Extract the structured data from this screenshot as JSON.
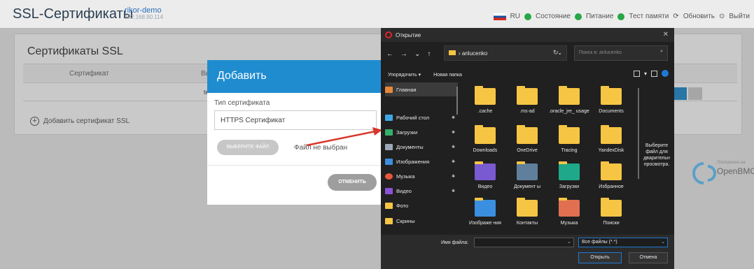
{
  "app": {
    "title": "SSL-Сертификаты",
    "host_name": "rikor-demo",
    "host_ip": "192.168.90.114"
  },
  "status_bar": {
    "lang": "RU",
    "state": "Состояние",
    "power": "Питание",
    "memtest": "Тест памяти",
    "refresh": "Обновить",
    "exit": "Выйти"
  },
  "card": {
    "title": "Сертификаты SSL",
    "col_cert": "Сертификат",
    "col_issued": "Выдан",
    "row_issued": "testho",
    "add_link": "Добавить сертификат SSL"
  },
  "add_dialog": {
    "title": "Добавить",
    "type_label": "Тип сертификата",
    "type_value": "HTTPS Сертификат",
    "choose_button": "ВЫБЕРИТЕ ФАЙЛ",
    "no_file": "Файл не выбран",
    "cancel_button": "ОТМЕНИТЬ"
  },
  "file_dialog": {
    "title": "Открытие",
    "path": "anlucenko",
    "search_placeholder": "Поиск в: anlucenko",
    "organize": "Упорядочить ▾",
    "new_folder": "Новая папка",
    "sidebar": [
      {
        "label": "Главная",
        "color": "#e8873a",
        "pinned": false
      },
      {
        "label": "Рабочий стол",
        "color": "#3fa7e6",
        "pinned": true
      },
      {
        "label": "Загрузки",
        "color": "#35b06a",
        "pinned": true
      },
      {
        "label": "Документы",
        "color": "#9aa7b6",
        "pinned": true
      },
      {
        "label": "Изображения",
        "color": "#3b8fe0",
        "pinned": true
      },
      {
        "label": "Музыка",
        "color": "#e8553a",
        "pinned": true
      },
      {
        "label": "Видео",
        "color": "#8a52d6",
        "pinned": true
      },
      {
        "label": "Фото",
        "color": "#f6c544",
        "pinned": false
      },
      {
        "label": "Скрины",
        "color": "#f6c544",
        "pinned": false
      }
    ],
    "files": [
      {
        "label": ".cache"
      },
      {
        "label": ".ms-ad"
      },
      {
        "label": ".oracle_jre_ usage"
      },
      {
        "label": "Documents"
      },
      {
        "label": "Downloads"
      },
      {
        "label": "OneDrive"
      },
      {
        "label": "Tracing"
      },
      {
        "label": "YandexDisk"
      },
      {
        "label": "Видео"
      },
      {
        "label": "Документ ы"
      },
      {
        "label": "Загрузки"
      },
      {
        "label": "Избранное"
      },
      {
        "label": "Изображе ния"
      },
      {
        "label": "Контакты"
      },
      {
        "label": "Музыка"
      },
      {
        "label": "Поиски"
      }
    ],
    "preview_hint": "Выберите файл для дварительн просмотра.",
    "filename_label": "Имя файла:",
    "filetype": "Все файлы (*.*)",
    "open_button": "Открыть",
    "cancel_button": "Отмена"
  },
  "brand": {
    "small": "Построено на",
    "name": "OpenBMC"
  }
}
